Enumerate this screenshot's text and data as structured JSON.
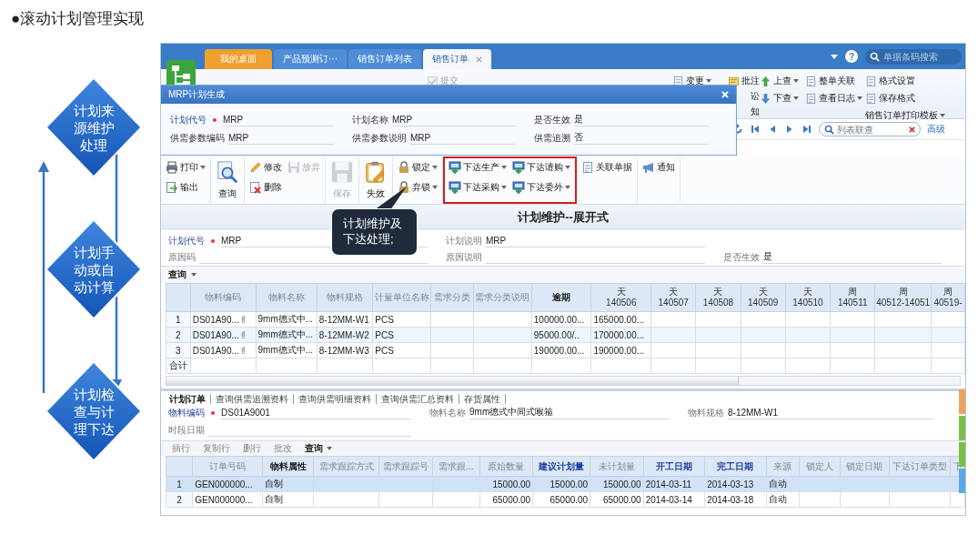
{
  "slide_title": "●滚动计划管理实现",
  "cycle_steps": [
    "计划来源维护处理",
    "计划手动或自动计算",
    "计划检查与计理下达"
  ],
  "tabs": [
    {
      "label": "我的桌面",
      "kind": "home",
      "selected": false,
      "closable": false
    },
    {
      "label": "产品预测订···",
      "kind": "doc",
      "selected": false,
      "closable": false
    },
    {
      "label": "销售订单列表",
      "kind": "doc",
      "selected": false,
      "closable": false
    },
    {
      "label": "销售订单",
      "kind": "doc",
      "selected": true,
      "closable": true
    }
  ],
  "help": "?",
  "barcode_search": {
    "placeholder": "单据条码搜索"
  },
  "ribbon": [
    [
      {
        "label": "提交",
        "caret": false,
        "disabled": true
      }
    ],
    [
      {
        "label": "变更",
        "caret": true,
        "disabled": false
      }
    ],
    [
      {
        "label": "批注",
        "caret": false,
        "disabled": false
      },
      {
        "label": "讼",
        "caret": false,
        "disabled": false
      },
      {
        "label": "知",
        "caret": false,
        "disabled": false
      }
    ],
    [
      {
        "label": "上查",
        "caret": true,
        "disabled": false
      },
      {
        "label": "下查",
        "caret": true,
        "disabled": false
      }
    ],
    [
      {
        "label": "整单关联",
        "caret": false,
        "disabled": false
      },
      {
        "label": "查看日志",
        "caret": true,
        "disabled": false
      }
    ],
    [
      {
        "label": "格式设置",
        "caret": false,
        "disabled": false
      },
      {
        "label": "保存格式",
        "caret": false,
        "disabled": false
      },
      {
        "label": "销售订单打印模板",
        "caret": true,
        "disabled": false
      }
    ]
  ],
  "list_search": {
    "placeholder": "列表联查"
  },
  "advanced_link": "高级",
  "dialog": {
    "title": "MRP计划生成",
    "fields": [
      [
        {
          "label": "计划代号",
          "required": true,
          "value": "MRP"
        },
        {
          "label": "计划名称",
          "required": false,
          "value": "MRP"
        },
        {
          "label": "是否生效",
          "required": false,
          "value": "是"
        }
      ],
      [
        {
          "label": "供需参数编码",
          "required": false,
          "value": "MRP"
        },
        {
          "label": "供需参数说明",
          "required": false,
          "value": "MRP"
        },
        {
          "label": "供需追溯",
          "required": false,
          "value": "否"
        }
      ]
    ]
  },
  "toolbar": [
    {
      "highlighted": false,
      "items": [
        {
          "label": "打印",
          "kind": "small",
          "caret": true,
          "disabled": false
        },
        {
          "label": "输出",
          "kind": "small",
          "caret": false,
          "disabled": false
        }
      ]
    },
    {
      "highlighted": false,
      "items": [
        {
          "label": "查询",
          "kind": "large",
          "caret": false,
          "disabled": false
        }
      ]
    },
    {
      "highlighted": false,
      "items": [
        {
          "label": "修改",
          "kind": "small",
          "caret": false,
          "disabled": false
        },
        {
          "label": "放弃",
          "kind": "small",
          "caret": false,
          "disabled": true
        },
        {
          "label": "删除",
          "kind": "small",
          "caret": false,
          "disabled": false
        }
      ]
    },
    {
      "highlighted": false,
      "items": [
        {
          "label": "保存",
          "kind": "large",
          "caret": false,
          "disabled": true
        }
      ]
    },
    {
      "highlighted": false,
      "items": [
        {
          "label": "失效",
          "kind": "large",
          "caret": false,
          "disabled": false
        }
      ]
    },
    {
      "highlighted": false,
      "items": [
        {
          "label": "锁定",
          "kind": "small",
          "caret": true,
          "disabled": false
        },
        {
          "label": "弃锁",
          "kind": "small",
          "caret": true,
          "disabled": false
        }
      ]
    },
    {
      "highlighted": true,
      "items": [
        {
          "label": "下达生产",
          "kind": "small",
          "caret": true,
          "disabled": false
        },
        {
          "label": "下达请购",
          "kind": "small",
          "caret": true,
          "disabled": false
        },
        {
          "label": "下达采购",
          "kind": "small",
          "caret": true,
          "disabled": false
        },
        {
          "label": "下达委外",
          "kind": "small",
          "caret": true,
          "disabled": false
        }
      ]
    },
    {
      "highlighted": false,
      "items": [
        {
          "label": "关联单据",
          "kind": "small",
          "caret": false,
          "disabled": false
        }
      ]
    },
    {
      "highlighted": false,
      "items": [
        {
          "label": "通知",
          "kind": "small",
          "caret": false,
          "disabled": false
        }
      ]
    }
  ],
  "callout": "计划维护及下达处理;",
  "view_title": "计划维护--展开式",
  "plan_fields": [
    [
      {
        "label": "计划代号",
        "required": true,
        "value": "MRP"
      },
      {
        "label": "计划说明",
        "required": false,
        "value": "MRP"
      }
    ],
    [
      {
        "label": "原因码",
        "required": false
      },
      {
        "label": "原因说明",
        "required": false
      },
      {
        "label": "是否生效",
        "required": false,
        "value": "是"
      }
    ]
  ],
  "grid_menu": "查询",
  "plan_table": {
    "columns": [
      {
        "label": "物料编码",
        "kind": "plain"
      },
      {
        "label": "物料名称",
        "kind": "plain"
      },
      {
        "label": "物料规格",
        "kind": "plain"
      },
      {
        "label": "计量单位名称",
        "kind": "plain"
      },
      {
        "label": "需求分类",
        "kind": "plain"
      },
      {
        "label": "需求分类说明",
        "kind": "plain"
      },
      {
        "label": "逾期",
        "kind": "bold"
      },
      {
        "label": "天",
        "sub": "140506",
        "kind": "dark"
      },
      {
        "label": "天",
        "sub": "140507",
        "kind": "dark"
      },
      {
        "label": "天",
        "sub": "140508",
        "kind": "dark"
      },
      {
        "label": "天",
        "sub": "140509",
        "kind": "dark"
      },
      {
        "label": "天",
        "sub": "140510",
        "kind": "dark"
      },
      {
        "label": "周",
        "sub": "140511",
        "kind": "dark"
      },
      {
        "label": "周",
        "sub": "40512-14051",
        "kind": "dark"
      },
      {
        "label": "周",
        "sub": "40519-",
        "kind": "dark"
      }
    ],
    "rows": [
      {
        "number": "1",
        "attachment": true,
        "cells": [
          "DS01A90...",
          "9mm德式中...",
          "8-12MM-W1",
          "PCS",
          null,
          null,
          "100000.00...",
          "165000.00...",
          null,
          null,
          null,
          null,
          null,
          null,
          null
        ]
      },
      {
        "number": "2",
        "attachment": true,
        "cells": [
          "DS01A90...",
          "9mm德式中...",
          "8-12MM-W2",
          "PCS",
          null,
          null,
          "95000.00/..",
          "170000.00...",
          null,
          null,
          null,
          null,
          null,
          null,
          null
        ]
      },
      {
        "number": "3",
        "attachment": true,
        "cells": [
          "DS01A90...",
          "9mm德式中...",
          "8-12MM-W3",
          "PCS",
          null,
          null,
          "190000.00...",
          "190000.00...",
          null,
          null,
          null,
          null,
          null,
          null,
          null
        ]
      }
    ],
    "total_label": "合计"
  },
  "detail_tabs": [
    {
      "label": "计划订单",
      "selected": true
    },
    {
      "label": "查询供需追溯资料",
      "selected": false
    },
    {
      "label": "查询供需明细资料",
      "selected": false
    },
    {
      "label": "查询供需汇总资料",
      "selected": false
    },
    {
      "label": "存货属性",
      "selected": false
    }
  ],
  "detail_fields": [
    [
      {
        "label": "物料编码",
        "required": true,
        "value": "DS01A9001"
      },
      {
        "label": "物料名称",
        "required": false,
        "value": "9mm德式中间式喉箍"
      },
      {
        "label": "物料规格",
        "required": false,
        "value": "8-12MM-W1"
      }
    ],
    [
      {
        "label": "时段日期",
        "required": false
      }
    ]
  ],
  "row_actions": [
    {
      "label": "插行",
      "caret": false,
      "disabled": true
    },
    {
      "label": "复制行",
      "caret": false,
      "disabled": true
    },
    {
      "label": "删行",
      "caret": false,
      "disabled": true
    },
    {
      "label": "批改",
      "caret": false,
      "disabled": true
    },
    {
      "label": "查询",
      "caret": true,
      "disabled": false
    }
  ],
  "order_table": {
    "columns": [
      {
        "label": "订单号码",
        "kind": "plain"
      },
      {
        "label": "物料属性",
        "kind": "bold"
      },
      {
        "label": "需求跟踪方式",
        "kind": "plain"
      },
      {
        "label": "需求跟踪号",
        "kind": "plain"
      },
      {
        "label": "需求跟...",
        "kind": "plain"
      },
      {
        "label": "原始数量",
        "kind": "plain"
      },
      {
        "label": "建议计划量",
        "kind": "accent"
      },
      {
        "label": "未计划量",
        "kind": "plain"
      },
      {
        "label": "开工日期",
        "kind": "accent"
      },
      {
        "label": "完工日期",
        "kind": "accent"
      },
      {
        "label": "来源",
        "kind": "plain"
      },
      {
        "label": "锁定人",
        "kind": "plain"
      },
      {
        "label": "锁定日期",
        "kind": "plain"
      },
      {
        "label": "下达订单类型",
        "kind": "plain"
      },
      {
        "label": "下",
        "kind": "plain"
      }
    ],
    "rows": [
      {
        "number": "1",
        "selected": true,
        "cells": [
          "GEN000000...",
          "自制",
          null,
          null,
          null,
          "15000.00",
          "15000.00",
          "15000.00",
          "2014-03-11",
          "2014-03-13",
          "自动",
          null,
          null,
          null,
          null
        ]
      },
      {
        "number": "2",
        "selected": false,
        "cells": [
          "GEN000000...",
          "自制",
          null,
          null,
          null,
          "65000.00",
          "65000.00",
          "65000.00",
          "2014-03-14",
          "2014-03-18",
          "自动",
          null,
          null,
          null,
          null
        ]
      }
    ]
  },
  "side_tabs": [
    {
      "color": "#eea35a"
    },
    {
      "color": "#7cc043"
    },
    {
      "color": "#7cc043"
    },
    {
      "color": "#5aa8e8"
    }
  ]
}
